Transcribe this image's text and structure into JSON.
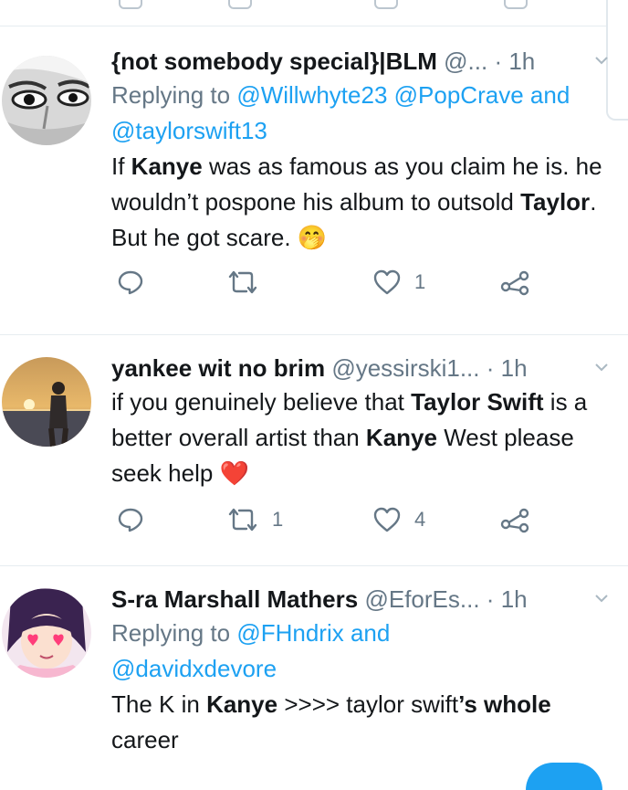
{
  "tweets": [
    {
      "name": "{not somebody special}|BLM",
      "handle": "@...",
      "dot": "·",
      "time": "1h",
      "reply_prefix": "Replying to",
      "reply_to_1": "@Willwhyte23",
      "reply_to_2": "@PopCrave",
      "reply_and": "and",
      "reply_to_3": "@taylorswift13",
      "body": [
        {
          "text": "If ",
          "bold": false
        },
        {
          "text": "Kanye",
          "bold": true
        },
        {
          "text": " was as famous as you claim he is. he wouldn’t pospone his album to outsold ",
          "bold": false
        },
        {
          "text": "Taylor",
          "bold": true
        },
        {
          "text": ". But he got scare. ",
          "bold": false
        },
        {
          "text": "🤭",
          "bold": false
        }
      ],
      "retweets": "",
      "likes": "1"
    },
    {
      "name": "yankee wit no brim",
      "handle": "@yessirski1...",
      "dot": "·",
      "time": "1h",
      "body": [
        {
          "text": "if you genuinely believe that ",
          "bold": false
        },
        {
          "text": "Taylor Swift",
          "bold": true
        },
        {
          "text": " is a better overall artist than ",
          "bold": false
        },
        {
          "text": "Kanye",
          "bold": true
        },
        {
          "text": " West please seek help ",
          "bold": false
        },
        {
          "text": "❤️",
          "bold": false
        }
      ],
      "retweets": "1",
      "likes": "4"
    },
    {
      "name": "S-ra Marshall Mathers",
      "handle": "@EforEs...",
      "dot": "·",
      "time": "1h",
      "reply_prefix": "Replying to",
      "reply_to_1": "@FHndrix",
      "reply_and": "and",
      "reply_to_2": "@davidxdevore",
      "body": [
        {
          "text": "The K in ",
          "bold": false
        },
        {
          "text": "Kanye",
          "bold": true
        },
        {
          "text": " >>>> taylor swift",
          "bold": false
        },
        {
          "text": "’s whole",
          "bold": true
        },
        {
          "text": " career",
          "bold": false
        }
      ]
    }
  ],
  "colors": {
    "link": "#1da1f2",
    "muted": "#657786",
    "text": "#14171a",
    "divider": "#e6ecf0",
    "heart": "#e0245e"
  },
  "icons": [
    "reply-icon",
    "retweet-icon",
    "like-icon",
    "share-icon",
    "chevron-down-icon"
  ]
}
